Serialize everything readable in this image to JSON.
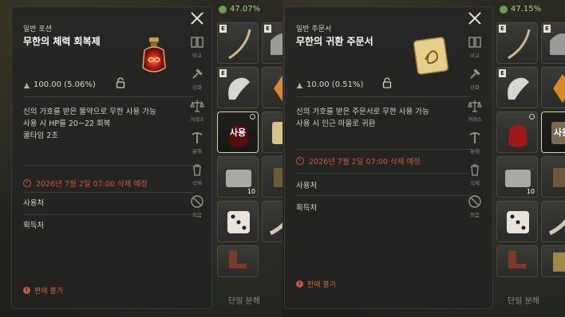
{
  "left": {
    "category": "일반 포션",
    "name": "무한의 체력 회복제",
    "weight": "100.00 (5.06%)",
    "description": [
      "신의 가호를 받은 물약으로 무한 사용 가능",
      "사용 시 HP를 20~22 회복",
      "쿨타임 2초"
    ],
    "expiry": "2026년 7월 2일 07:00 삭제 예정",
    "usage_label": "사용처",
    "source_label": "획득처",
    "footer": "판매 불가",
    "side_actions": [
      "비교",
      "강화",
      "거래소",
      "분해",
      "삭제",
      "죄음"
    ],
    "percent": "47.07%",
    "slot_labels": {
      "use": "사용",
      "count": "10"
    },
    "bottom_hint": "단일 분해"
  },
  "right": {
    "category": "일반 주문서",
    "name": "무한의 귀환 주문서",
    "weight": "10.00 (0.51%)",
    "description": [
      "신의 가호를 받은 주문서로 무한 사용 가능",
      "사용 시 인근 마을로 귀환"
    ],
    "expiry": "2026년 7월 2일 07:00 삭제 예정",
    "usage_label": "사용처",
    "source_label": "획득처",
    "footer": "판매 불가",
    "side_actions": [
      "비교",
      "강화",
      "거래소",
      "분해",
      "삭제",
      "죄음"
    ],
    "percent": "47.15%",
    "slot_labels": {
      "use": "사용",
      "count": "10"
    },
    "bottom_hint": "단일 분해"
  },
  "colors": {
    "warning": "#d2583c",
    "percent": "#a6d47e",
    "panel": "#242423"
  }
}
